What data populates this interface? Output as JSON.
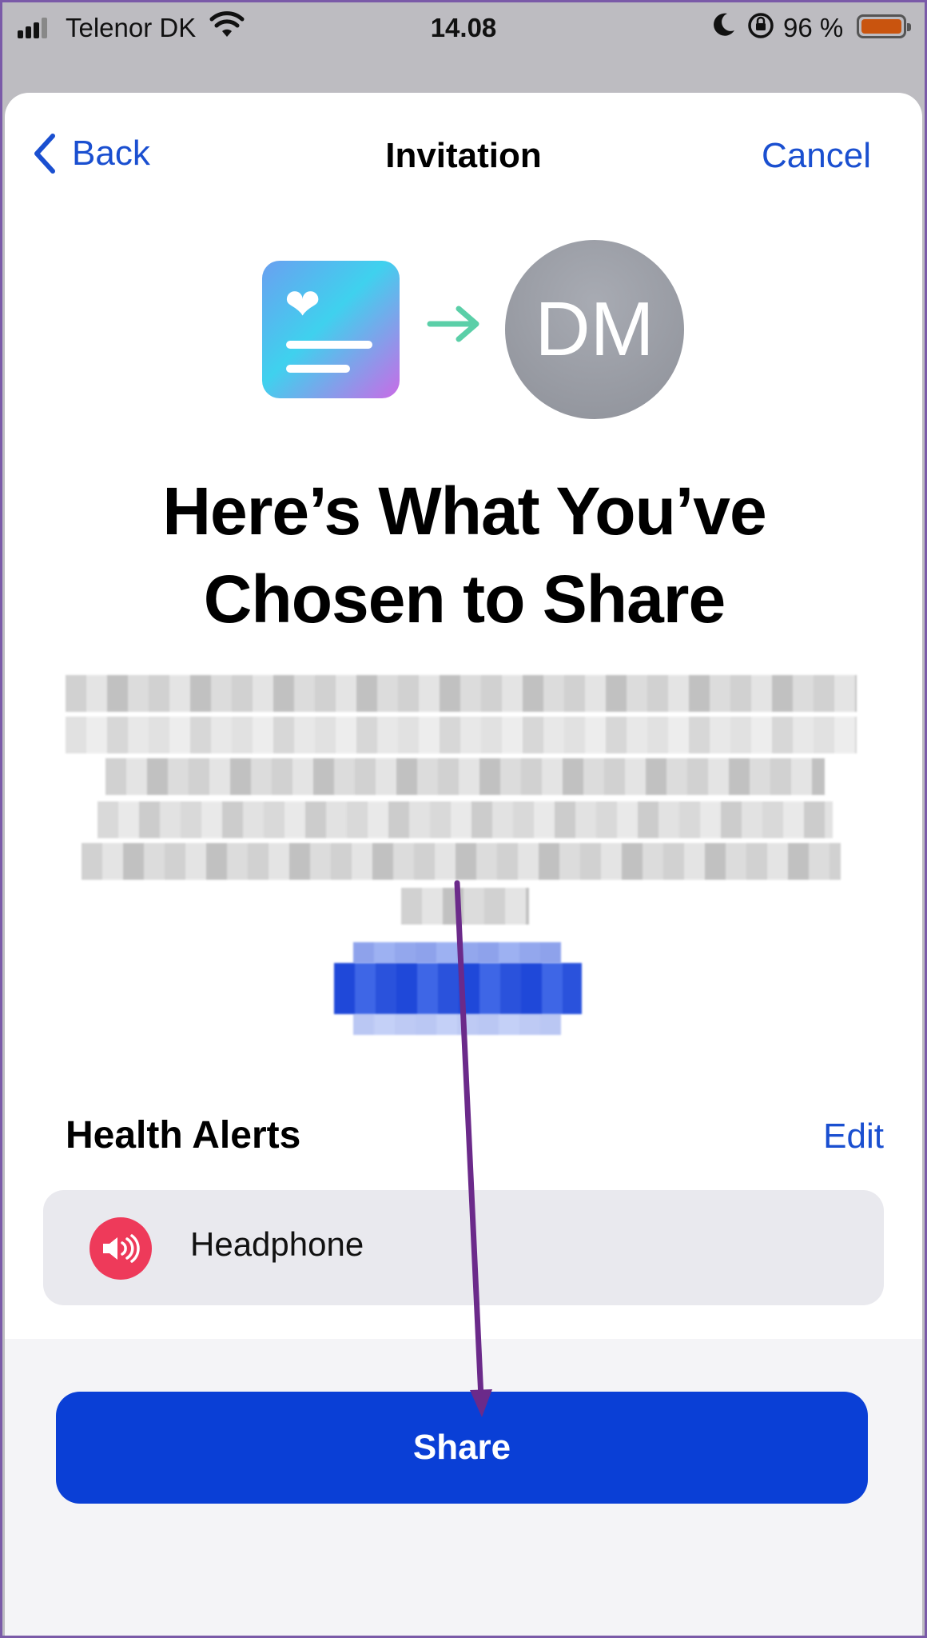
{
  "status_bar": {
    "carrier": "Telenor DK",
    "time": "14.08",
    "battery_percent": "96 %",
    "battery_color": "#c9540e",
    "icons": [
      "signal-icon",
      "wifi-icon",
      "moon-icon",
      "rotation-lock-icon",
      "battery-icon"
    ]
  },
  "nav": {
    "back_label": "Back",
    "title": "Invitation",
    "cancel_label": "Cancel"
  },
  "hero": {
    "source_icon": "health-document-icon",
    "arrow_icon": "arrow-right-icon",
    "avatar_initials": "DM"
  },
  "headline": "Here’s What You’ve Chosen to Share",
  "health_alerts": {
    "title": "Health Alerts",
    "edit_label": "Edit",
    "items": [
      {
        "label": "Headphone",
        "icon": "speaker-icon",
        "icon_color": "#ee3a5a"
      }
    ]
  },
  "share_button_label": "Share",
  "colors": {
    "accent": "#1a4fd0",
    "primary_button": "#0a3fd6",
    "annotation": "#6b2a8a"
  }
}
